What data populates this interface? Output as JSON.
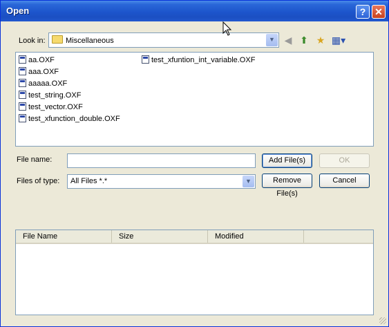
{
  "window": {
    "title": "Open"
  },
  "lookin": {
    "label": "Look in:",
    "value": "Miscellaneous"
  },
  "files": [
    "aa.OXF",
    "aaa.OXF",
    "aaaaa.OXF",
    "test_string.OXF",
    "test_vector.OXF",
    "test_xfunction_double.OXF",
    "test_xfuntion_int_variable.OXF"
  ],
  "filename": {
    "label": "File name:",
    "value": ""
  },
  "filetype": {
    "label": "Files of type:",
    "value": "All Files *.*"
  },
  "buttons": {
    "add": "Add File(s)",
    "ok": "OK",
    "remove": "Remove File(s)",
    "cancel": "Cancel"
  },
  "columns": [
    "File Name",
    "Size",
    "Modified"
  ]
}
